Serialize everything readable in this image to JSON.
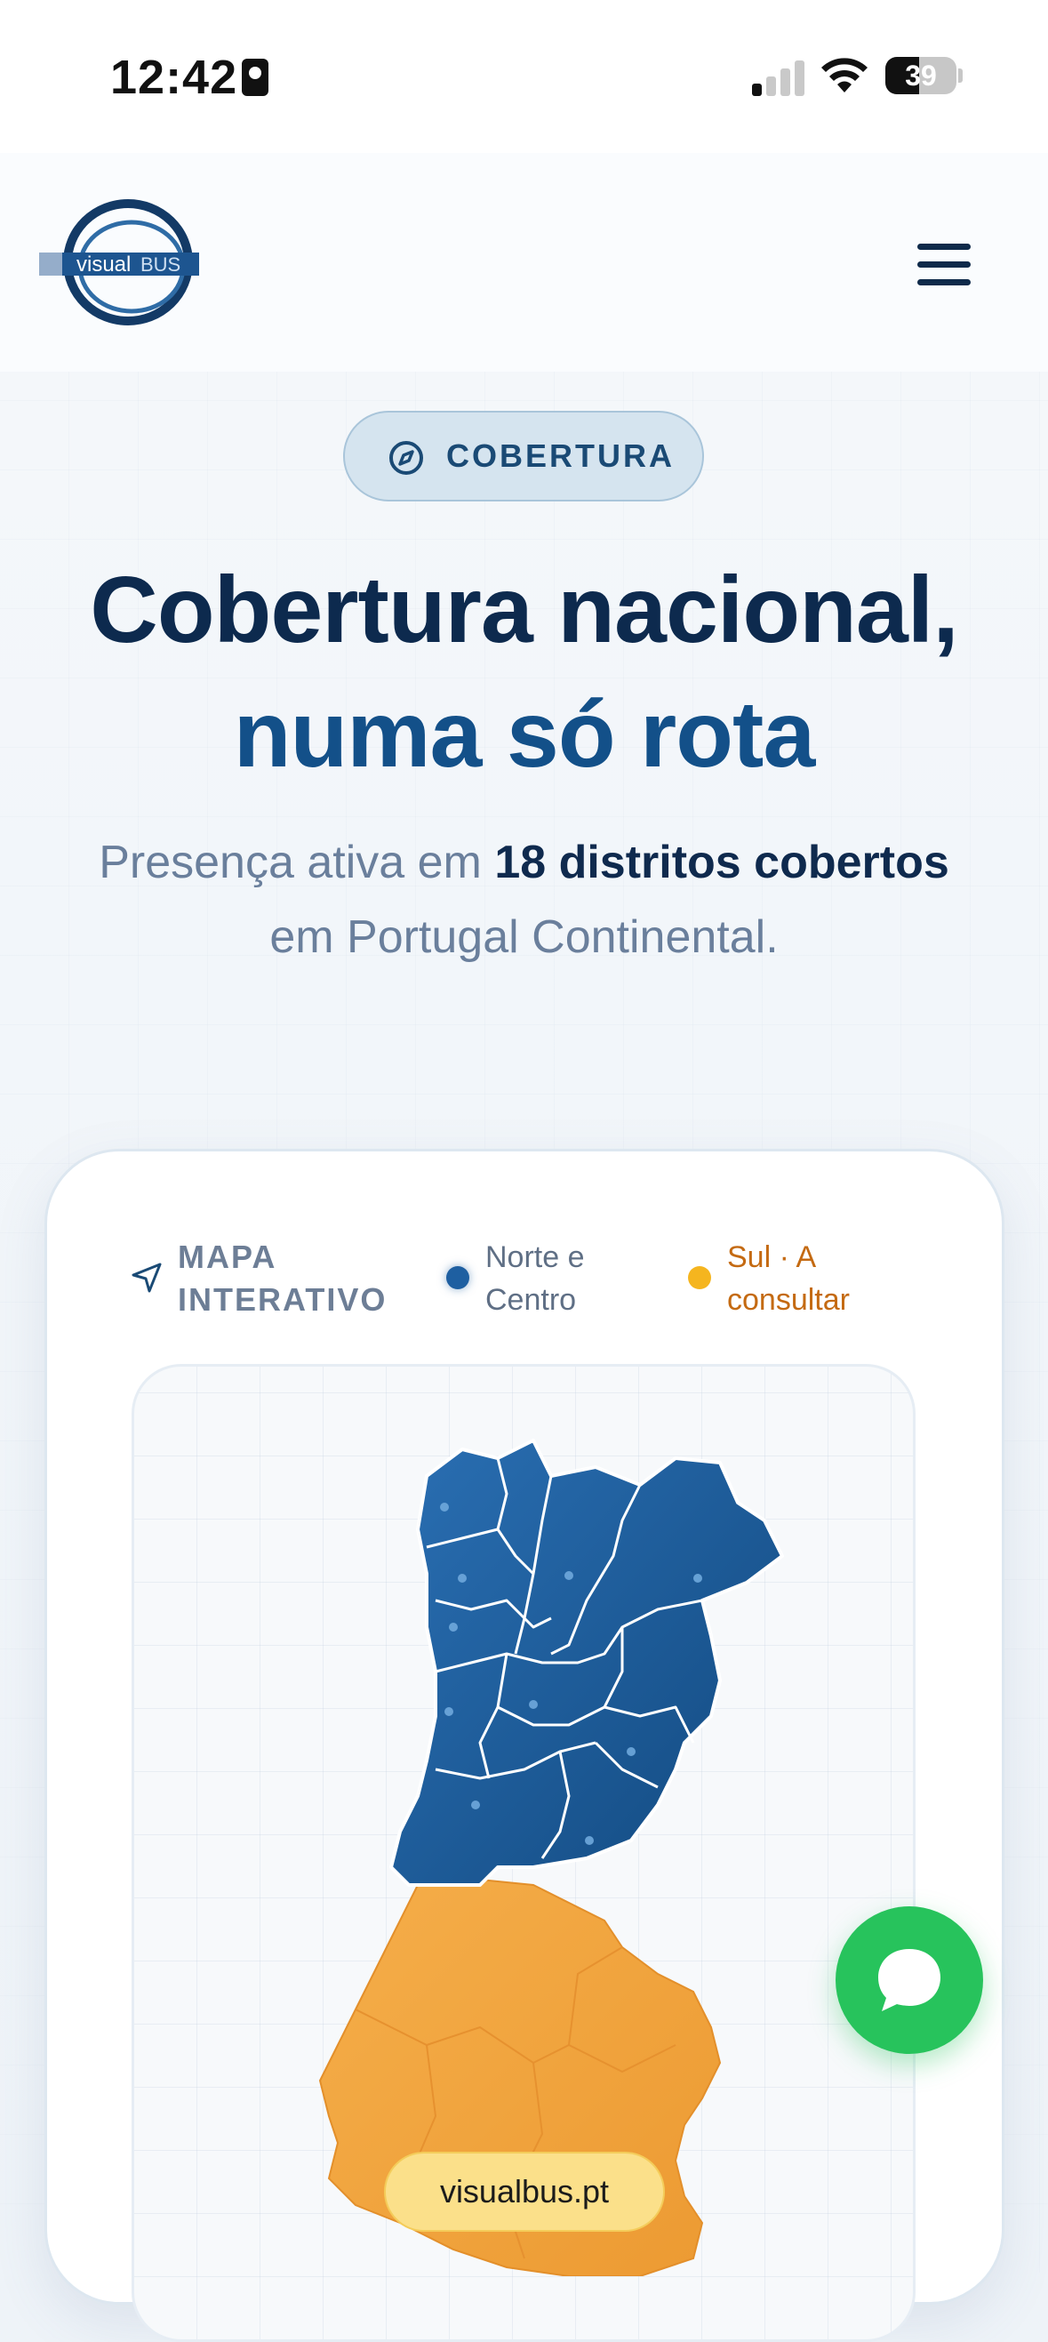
{
  "status_bar": {
    "time": "12:42",
    "battery": "39"
  },
  "header": {
    "logo_text_1": "visual",
    "logo_text_2": "BUS"
  },
  "hero": {
    "badge": "COBERTURA",
    "title_line1": "Cobertura nacional,",
    "title_line2": "numa só rota",
    "subtitle_pre": "Presença ativa em ",
    "subtitle_bold": "18 distritos cobertos",
    "subtitle_line2": "em Portugal Continental."
  },
  "map_card": {
    "legend_title_1": "MAPA",
    "legend_title_2": "INTERATIVO",
    "legend_north_1": "Norte e",
    "legend_north_2": "Centro",
    "legend_south_1": "Sul · A",
    "legend_south_2": "consultar",
    "url": "visualbus.pt"
  },
  "colors": {
    "north": "#1e5fa1",
    "south": "#f2a43a",
    "title_dark": "#0d2a4e",
    "title_blue": "#135089",
    "chat": "#27c35c"
  },
  "icons": [
    "id-card-icon",
    "cellular-signal-icon",
    "wifi-icon",
    "battery-icon",
    "hamburger-menu-icon",
    "compass-icon",
    "navigation-arrow-icon",
    "chat-bubble-icon"
  ]
}
